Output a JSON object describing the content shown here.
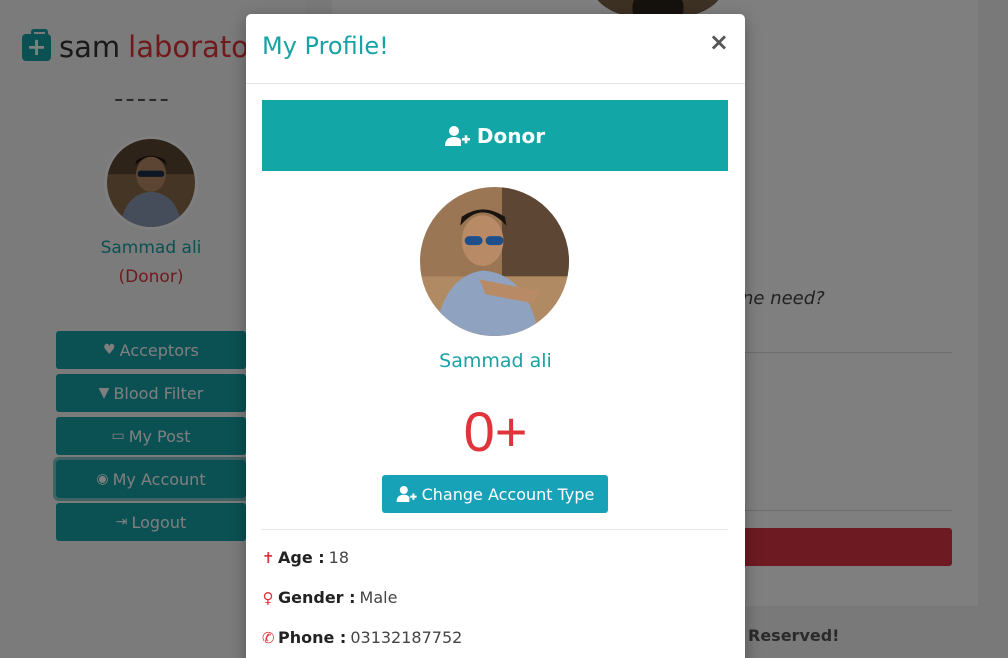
{
  "app": {
    "brand_part1": "sam",
    "brand_part2": "laborato",
    "dashes": "-----"
  },
  "sidebar": {
    "user_name": "Sammad ali",
    "user_role": "(Donor)",
    "items": [
      {
        "label": "Acceptors",
        "icon": "heartbeat-icon"
      },
      {
        "label": "Blood Filter",
        "icon": "filter-icon"
      },
      {
        "label": "My Post",
        "icon": "folder-open-icon"
      },
      {
        "label": "My Account",
        "icon": "user-circle-icon"
      },
      {
        "label": "Logout",
        "icon": "sign-out-icon"
      }
    ]
  },
  "background": {
    "question_text": "ne need?",
    "footer_text": "Reserved!"
  },
  "modal": {
    "title": "My Profile!",
    "close_label": "×",
    "donor_label": "Donor",
    "name": "Sammad ali",
    "blood_group": "0+",
    "change_button_label": "Change Account Type",
    "info": [
      {
        "label": "Age :",
        "value": "18",
        "icon": "child-icon"
      },
      {
        "label": "Gender :",
        "value": "Male",
        "icon": "venus-icon"
      },
      {
        "label": "Phone :",
        "value": "03132187752",
        "icon": "phone-icon"
      }
    ]
  },
  "colors": {
    "teal": "#17a2a6",
    "red": "#e0343a",
    "info_blue": "#17a2b8"
  }
}
